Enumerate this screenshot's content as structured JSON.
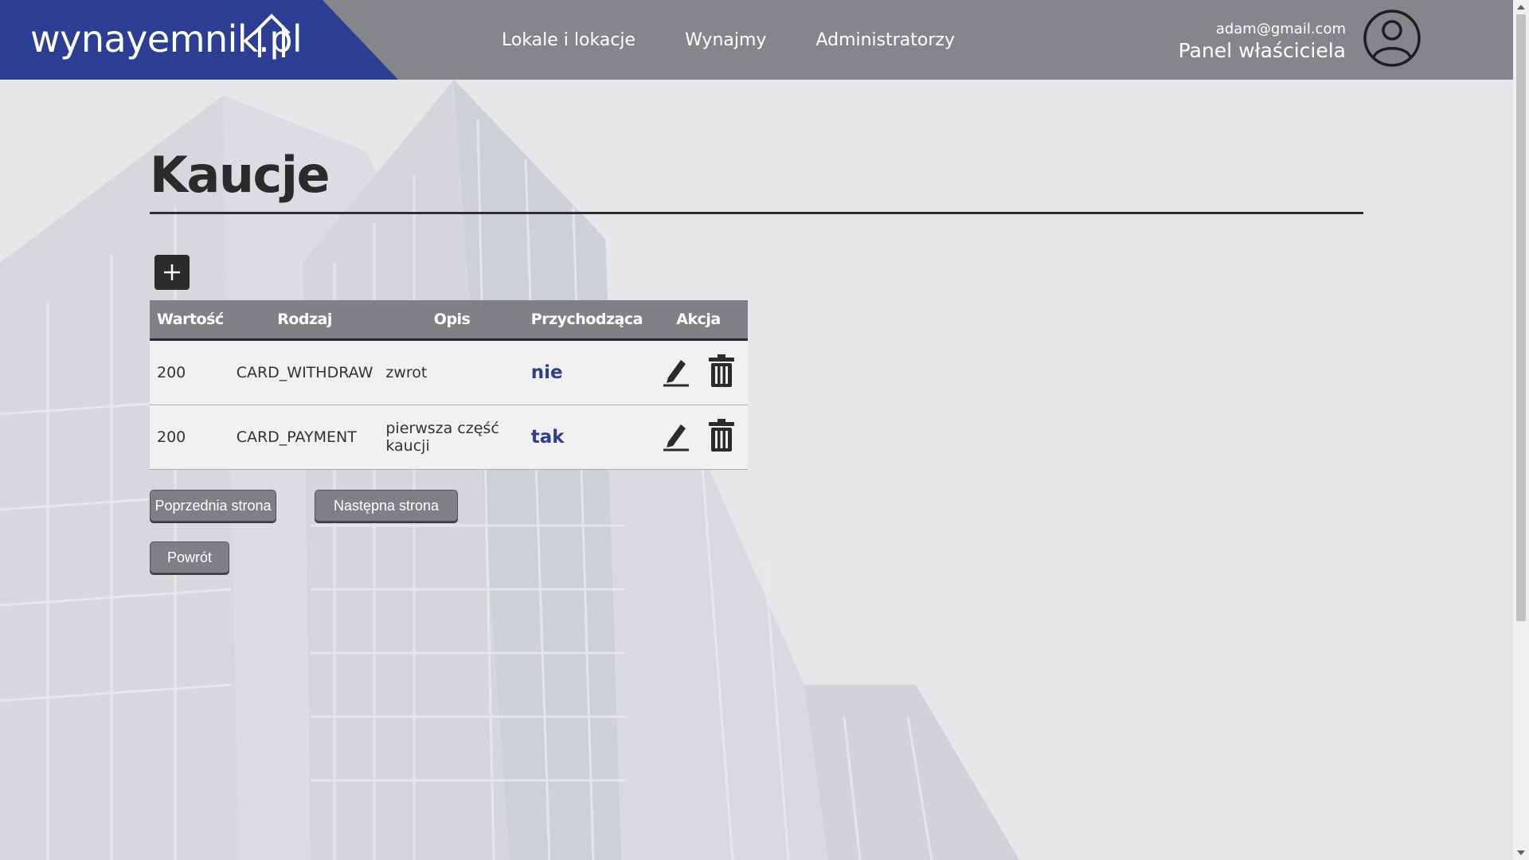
{
  "header": {
    "logo": "wynayemnik.pl",
    "nav": [
      "Lokale i lokacje",
      "Wynajmy",
      "Administratorzy"
    ],
    "user_email": "adam@gmail.com",
    "user_role": "Panel właściciela"
  },
  "page": {
    "title": "Kaucje",
    "add_icon": "plus-icon"
  },
  "table": {
    "headers": [
      "Wartość",
      "Rodzaj",
      "Opis",
      "Przychodząca",
      "Akcja"
    ],
    "rows": [
      {
        "value": "200",
        "type": "CARD_WITHDRAW",
        "description": "zwrot",
        "incoming": "nie"
      },
      {
        "value": "200",
        "type": "CARD_PAYMENT",
        "description": "pierwsza część kaucji",
        "incoming": "tak"
      }
    ],
    "action_icons": [
      "pencil-icon",
      "trash-icon"
    ]
  },
  "buttons": {
    "prev": "Poprzednia strona",
    "next": "Następna strona",
    "back": "Powrót"
  },
  "colors": {
    "brand_blue": "#2c3f94",
    "header_gray": "#85868a",
    "flag_text": "#2d3e8c"
  }
}
